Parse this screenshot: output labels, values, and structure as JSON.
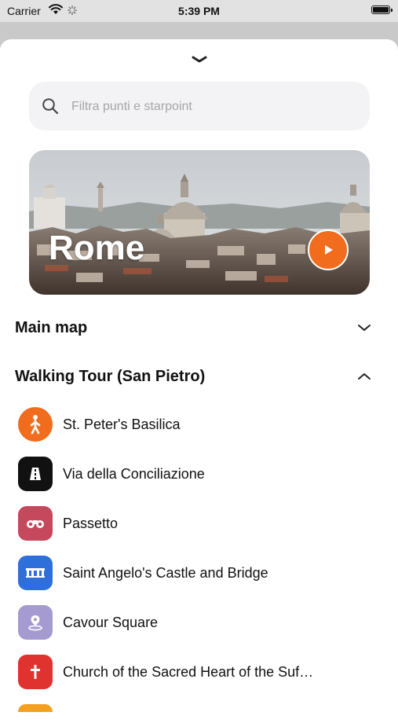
{
  "status_bar": {
    "carrier": "Carrier",
    "time": "5:39 PM"
  },
  "search": {
    "placeholder": "Filtra punti e starpoint",
    "value": ""
  },
  "hero": {
    "title": "Rome",
    "play_color": "#f26c1e"
  },
  "sections": [
    {
      "title": "Main map",
      "expanded": false
    },
    {
      "title": "Walking Tour (San Pietro)",
      "expanded": true
    }
  ],
  "tour_items": [
    {
      "label": "St. Peter's Basilica",
      "icon": "walking-person-icon",
      "color": "#f26c1e"
    },
    {
      "label": "Via della Conciliazione",
      "icon": "road-icon",
      "color": "#111111"
    },
    {
      "label": "Passetto",
      "icon": "binoculars-icon",
      "color": "#c5485c"
    },
    {
      "label": "Saint Angelo's Castle and Bridge",
      "icon": "bridge-icon",
      "color": "#2f6fdc"
    },
    {
      "label": "Cavour Square",
      "icon": "location-pin-icon",
      "color": "#a59bd1"
    },
    {
      "label": "Church of the Sacred Heart of the Suf…",
      "icon": "cross-icon",
      "color": "#e0322e"
    }
  ]
}
